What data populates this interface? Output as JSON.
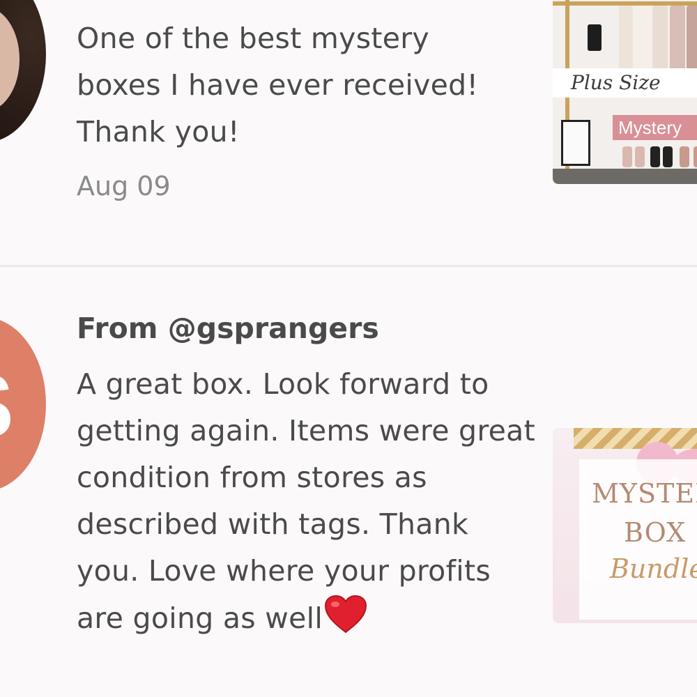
{
  "reviews": [
    {
      "from": "",
      "text": "One of the best mystery boxes I have ever received! Thank you!",
      "date": "Aug 09",
      "avatar_type": "photo",
      "product_image": {
        "script_label": "Plus Size",
        "band_label": "Mystery"
      }
    },
    {
      "from": "From @gsprangers",
      "text": "A great box. Look forward to getting again. Items were great condition from stores as described with tags. Thank you. Love where your profits are going as well",
      "emoji": "heart-emoji",
      "avatar_type": "initial",
      "avatar_initial": "S",
      "avatar_color": "#de8068",
      "product_image": {
        "title_line1": "MYSTERY",
        "title_line2": "BOX",
        "title_line3": "Bundle"
      }
    }
  ],
  "colors": {
    "background": "#fbf9fa",
    "text": "#4a4a4a",
    "date_text": "#8a8a8a",
    "divider": "#ece8ea",
    "heart": "#e0202e"
  }
}
